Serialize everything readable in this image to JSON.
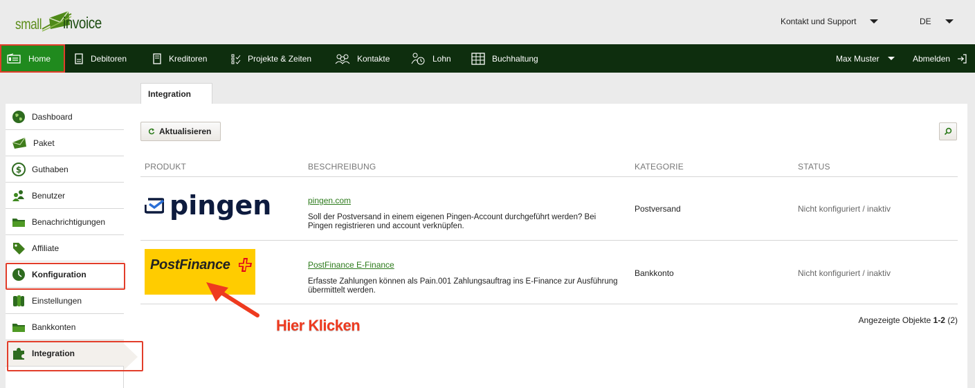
{
  "app": {
    "logo_small": "small",
    "logo_invoice": "invoice"
  },
  "topbar": {
    "support_label": "Kontakt und Support",
    "language": "DE"
  },
  "nav": {
    "items": [
      {
        "label": "Home",
        "icon": "home-icon"
      },
      {
        "label": "Debitoren",
        "icon": "document-icon"
      },
      {
        "label": "Kreditoren",
        "icon": "document-icon"
      },
      {
        "label": "Projekte & Zeiten",
        "icon": "checklist-icon"
      },
      {
        "label": "Kontakte",
        "icon": "people-icon"
      },
      {
        "label": "Lohn",
        "icon": "payroll-icon"
      },
      {
        "label": "Buchhaltung",
        "icon": "ledger-icon"
      }
    ],
    "user_label": "Max Muster",
    "logout_label": "Abmelden"
  },
  "tab": {
    "label": "Integration"
  },
  "sidebar": {
    "items": [
      {
        "label": "Dashboard",
        "icon": "globe-icon"
      },
      {
        "label": "Paket",
        "icon": "envelope-icon"
      },
      {
        "label": "Guthaben",
        "icon": "dollar-icon"
      },
      {
        "label": "Benutzer",
        "icon": "users-icon"
      },
      {
        "label": "Benachrichtigungen",
        "icon": "folder-icon"
      },
      {
        "label": "Affiliate",
        "icon": "tag-icon"
      },
      {
        "label": "Konfiguration",
        "icon": "clock-icon"
      },
      {
        "label": "Einstellungen",
        "icon": "binders-icon"
      },
      {
        "label": "Bankkonten",
        "icon": "folder-icon"
      },
      {
        "label": "Integration",
        "icon": "puzzle-icon"
      }
    ]
  },
  "toolbar": {
    "refresh_label": "Aktualisieren"
  },
  "table": {
    "headers": [
      "PRODUKT",
      "BESCHREIBUNG",
      "KATEGORIE",
      "STATUS"
    ],
    "rows": [
      {
        "logo_text": "pingen",
        "link": "pingen.com",
        "description": "Soll der Postversand in einem eigenen Pingen-Account durchgeführt werden? Bei Pingen registrieren und account verknüpfen.",
        "category": "Postversand",
        "status": "Nicht konfiguriert / inaktiv"
      },
      {
        "logo_text": "PostFinance",
        "link": "PostFinance E-Finance",
        "description": "Erfasste Zahlungen können als Pain.001 Zahlungsauftrag ins E-Finance zur Ausführung übermittelt werden.",
        "category": "Bankkonto",
        "status": "Nicht konfiguriert / inaktiv"
      }
    ]
  },
  "pagination": {
    "prefix": "Angezeigte Objekte",
    "range": "1-2",
    "total": "(2)"
  },
  "annotation": {
    "text": "Hier Klicken"
  },
  "colors": {
    "nav_bg": "#0e2e0e",
    "accent_green": "#208a1e",
    "highlight_red": "#e23d2a",
    "link_green": "#2c7a1b",
    "postfinance_yellow": "#ffcc00"
  }
}
